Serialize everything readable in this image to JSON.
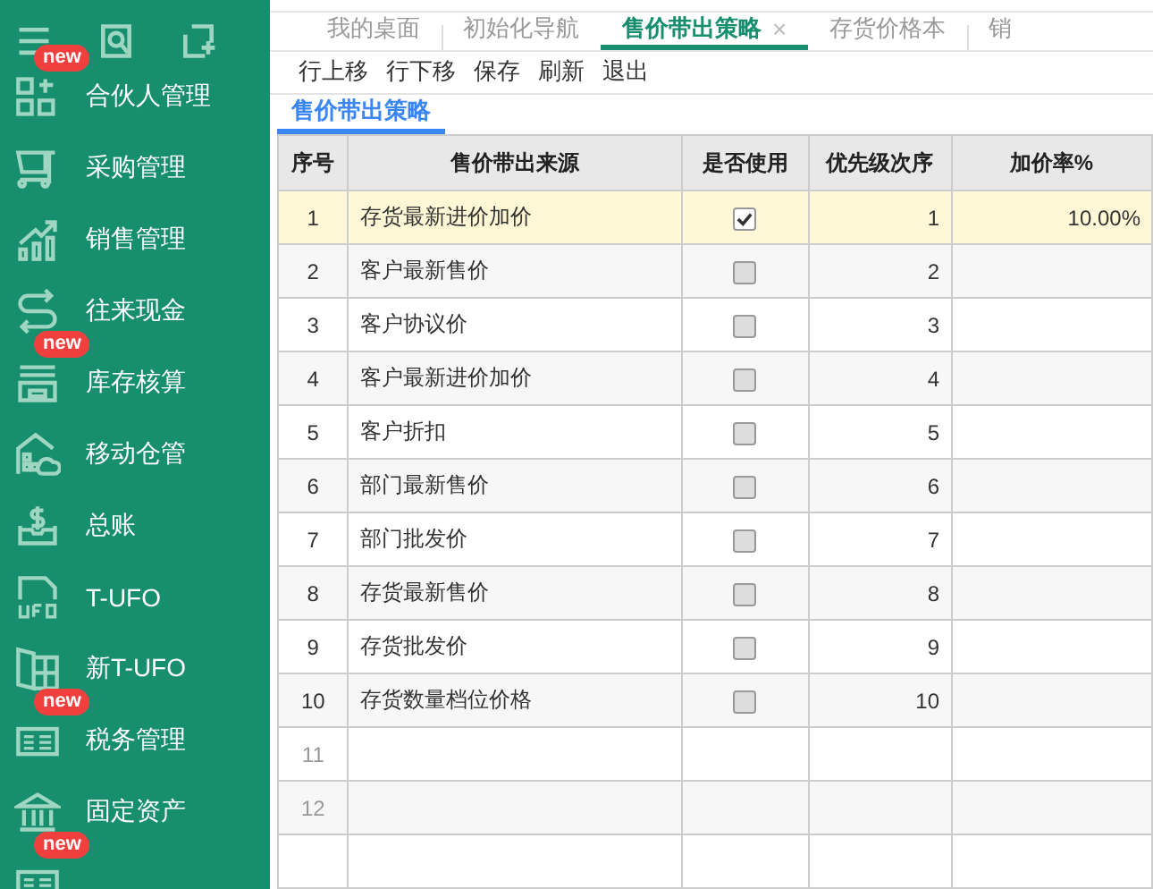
{
  "sidebar": {
    "items": [
      {
        "label": "合伙人管理",
        "kind": "partner",
        "badge": "new"
      },
      {
        "label": "采购管理",
        "kind": "cart"
      },
      {
        "label": "销售管理",
        "kind": "chart"
      },
      {
        "label": "往来现金",
        "kind": "exchange"
      },
      {
        "label": "库存核算",
        "kind": "stock",
        "badge": "new"
      },
      {
        "label": "移动仓管",
        "kind": "cloud"
      },
      {
        "label": "总账",
        "kind": "ledger"
      },
      {
        "label": "T-UFO",
        "kind": "ufo"
      },
      {
        "label": "新T-UFO",
        "kind": "ufo2"
      },
      {
        "label": "税务管理",
        "kind": "tax",
        "badge": "new"
      },
      {
        "label": "固定资产",
        "kind": "bank"
      },
      {
        "kind": "tax",
        "badge": "new"
      }
    ]
  },
  "tabs": [
    {
      "label": "我的桌面",
      "selected": false
    },
    {
      "label": "初始化导航",
      "selected": false
    },
    {
      "label": "售价带出策略",
      "selected": true,
      "close": "×"
    },
    {
      "label": "存货价格本",
      "selected": false
    },
    {
      "label": "销",
      "selected": false
    }
  ],
  "toolbar": [
    "行上移",
    "行下移",
    "保存",
    "刷新",
    "退出"
  ],
  "subtab": {
    "label": "售价带出策略",
    "selected": true
  },
  "table": {
    "columns": [
      "序号",
      "售价带出来源",
      "是否使用",
      "优先级次序",
      "加价率%"
    ],
    "rows": [
      {
        "no": "1",
        "source": "存货最新进价加价",
        "used": true,
        "priority": "1",
        "rate": "10.00%",
        "selected": true
      },
      {
        "no": "2",
        "source": "客户最新售价",
        "used": false,
        "priority": "2",
        "selected": false
      },
      {
        "no": "3",
        "source": "客户协议价",
        "used": false,
        "priority": "3",
        "selected": false
      },
      {
        "no": "4",
        "source": "客户最新进价加价",
        "used": false,
        "priority": "4",
        "selected": false
      },
      {
        "no": "5",
        "source": "客户折扣",
        "used": false,
        "priority": "5",
        "selected": false
      },
      {
        "no": "6",
        "source": "部门最新售价",
        "used": false,
        "priority": "6",
        "selected": false
      },
      {
        "no": "7",
        "source": "部门批发价",
        "used": false,
        "priority": "7",
        "selected": false
      },
      {
        "no": "8",
        "source": "存货最新售价",
        "used": false,
        "priority": "8",
        "selected": false
      },
      {
        "no": "9",
        "source": "存货批发价",
        "used": false,
        "priority": "9",
        "selected": false
      },
      {
        "no": "10",
        "source": "存货数量档位价格",
        "used": false,
        "priority": "10",
        "selected": false
      }
    ],
    "empty_rows": [
      "11",
      "12"
    ]
  }
}
